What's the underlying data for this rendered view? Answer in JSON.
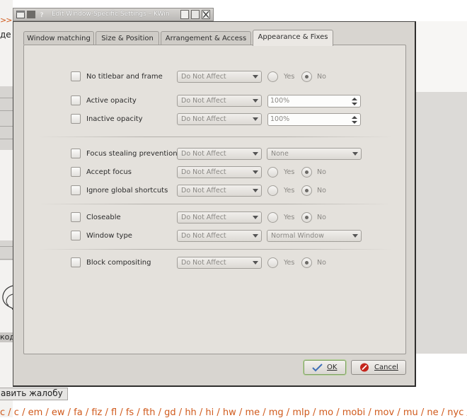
{
  "window": {
    "title": "Edit Window-Specific Settings – KWin",
    "tabs": [
      {
        "label": "Window matching",
        "active": false
      },
      {
        "label": "Size & Position",
        "active": false
      },
      {
        "label": "Arrangement & Access",
        "active": false
      },
      {
        "label": "Appearance & Fixes",
        "active": true
      }
    ],
    "rows": [
      {
        "label": "No titlebar and frame",
        "combo": "Do Not Affect",
        "radio_yes": "Yes",
        "radio_no": "No",
        "selected": "No"
      },
      {
        "label": "Active opacity",
        "combo": "Do Not Affect",
        "value": "100%"
      },
      {
        "label": "Inactive opacity",
        "combo": "Do Not Affect",
        "value": "100%"
      },
      {
        "label": "Focus stealing prevention",
        "combo": "Do Not Affect",
        "value_combo": "None"
      },
      {
        "label": "Accept focus",
        "combo": "Do Not Affect",
        "radio_yes": "Yes",
        "radio_no": "No",
        "selected": "No"
      },
      {
        "label": "Ignore global shortcuts",
        "combo": "Do Not Affect",
        "radio_yes": "Yes",
        "radio_no": "No",
        "selected": "No"
      },
      {
        "label": "Closeable",
        "combo": "Do Not Affect",
        "radio_yes": "Yes",
        "radio_no": "No",
        "selected": "No"
      },
      {
        "label": "Window type",
        "combo": "Do Not Affect",
        "value_combo": "Normal Window"
      },
      {
        "label": "Block compositing",
        "combo": "Do Not Affect",
        "radio_yes": "Yes",
        "radio_no": "No",
        "selected": "No"
      }
    ],
    "buttons": {
      "ok": "OK",
      "cancel": "Cancel"
    }
  },
  "background": {
    "arrow": ">>",
    "fragment": "де",
    "kod": "код",
    "complaint_button": "авить жалобу",
    "links": "с / с / em / ew / fa / fiz / fl / fs / fth / gd / hh / hi / hw / me / mg / mlp / mo / mobi / mov / mu / ne / nyc / no"
  },
  "colors": {
    "link": "#d05a1c",
    "window_bg": "#d8d5d0",
    "panel_bg": "#e4e1dc",
    "ok_border": "#7fa163",
    "cancel_icon": "#c4251c"
  }
}
